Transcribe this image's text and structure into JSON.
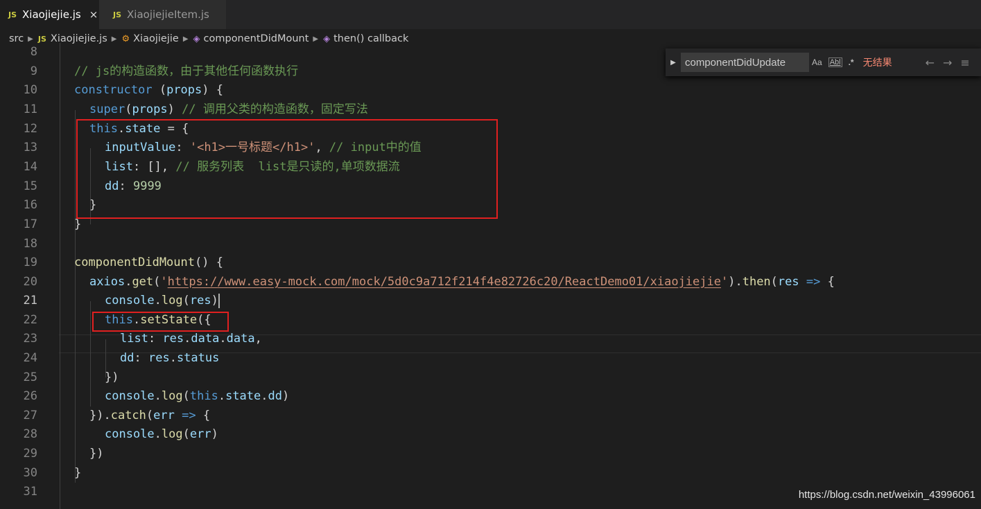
{
  "tabs": [
    {
      "badge": "JS",
      "label": "Xiaojiejie.js",
      "close": "×"
    },
    {
      "badge": "JS",
      "label": "XiaojiejieItem.js"
    }
  ],
  "breadcrumb": {
    "src": "src",
    "file_badge": "JS",
    "file": "Xiaojiejie.js",
    "class": "Xiaojiejie",
    "method": "componentDidMount",
    "callback": "then() callback"
  },
  "find": {
    "value": "componentDidUpdate",
    "opt_case": "Aa",
    "opt_word": "Abl",
    "opt_regex": ".*",
    "status": "无结果"
  },
  "colors": {
    "keyword": "#569cd6",
    "function": "#dcdcaa",
    "variable": "#9cdcfe",
    "string": "#ce9178",
    "number": "#b5cea8",
    "comment": "#6a9955",
    "highlight_box": "#e02020"
  },
  "code": {
    "l8": "8",
    "l9": "9",
    "c9": "// js的构造函数，由于其他任何函数执行",
    "l10": "10",
    "k10": "constructor",
    "v10": "props",
    "l11": "11",
    "k11": "super",
    "v11": "props",
    "c11": "// 调用父类的构造函数，固定写法",
    "l12": "12",
    "k12": "this",
    "v12": "state",
    "l13": "13",
    "v13": "inputValue",
    "s13": "'<h1>一号标题</h1>'",
    "c13": "// input中的值",
    "l14": "14",
    "v14": "list",
    "c14": "// 服务列表  list是只读的,单项数据流",
    "l15": "15",
    "v15": "dd",
    "n15": "9999",
    "l16": "16",
    "l17": "17",
    "l18": "18",
    "l19": "19",
    "f19": "componentDidMount",
    "l20": "20",
    "v20a": "axios",
    "f20a": "get",
    "s20": "https://www.easy-mock.com/mock/5d0c9a712f214f4e82726c20/ReactDemo01/xiaojiejie",
    "f20b": "then",
    "v20b": "res",
    "l21": "21",
    "v21a": "console",
    "f21": "log",
    "v21b": "res",
    "l22": "22",
    "k22": "this",
    "f22": "setState",
    "l23": "23",
    "v23a": "list",
    "v23b": "res",
    "v23c": "data",
    "v23d": "data",
    "l24": "24",
    "v24a": "dd",
    "v24b": "res",
    "v24c": "status",
    "l25": "25",
    "l26": "26",
    "v26a": "console",
    "f26": "log",
    "k26": "this",
    "v26b": "state",
    "v26c": "dd",
    "l27": "27",
    "f27": "catch",
    "v27": "err",
    "l28": "28",
    "v28a": "console",
    "f28": "log",
    "v28b": "err",
    "l29": "29",
    "l30": "30",
    "l31": "31"
  },
  "watermark": "https://blog.csdn.net/weixin_43996061"
}
